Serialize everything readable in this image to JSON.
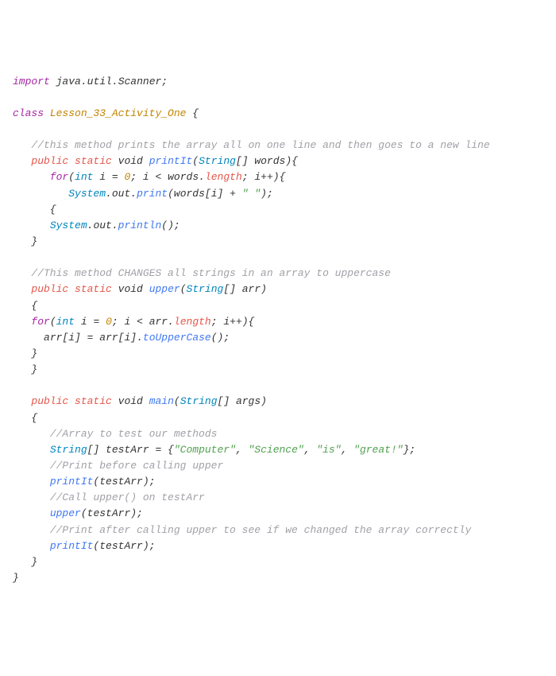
{
  "code": {
    "imp": "import",
    "javaPkg": "java",
    "utilPkg": "util",
    "scannerCls": "Scanner",
    "classKw": "class",
    "className": "Lesson_33_Activity_One",
    "cmt1": "//this method prints the array all on one line and then goes to a new line",
    "public": "public",
    "static": "static",
    "voidKw": "void",
    "printIt": "printIt",
    "String": "String",
    "words": "words",
    "forKw": "for",
    "intKw": "int",
    "i": "i",
    "zero": "0",
    "length": "length",
    "System": "System",
    "out": "out",
    "print": "print",
    "space": "\" \"",
    "println": "println",
    "cmt2": "//This method CHANGES all strings in an array to uppercase",
    "upper": "upper",
    "arr": "arr",
    "toUpperCase": "toUpperCase",
    "main": "main",
    "args": "args",
    "cmt3": "//Array to test our methods",
    "testArr": "testArr",
    "sComputer": "\"Computer\"",
    "sScience": "\"Science\"",
    "sIs": "\"is\"",
    "sGreat": "\"great!\"",
    "cmt4": "//Print before calling upper",
    "cmt5": "//Call upper() on testArr",
    "cmt6": "//Print after calling upper to see if we changed the array correctly"
  }
}
